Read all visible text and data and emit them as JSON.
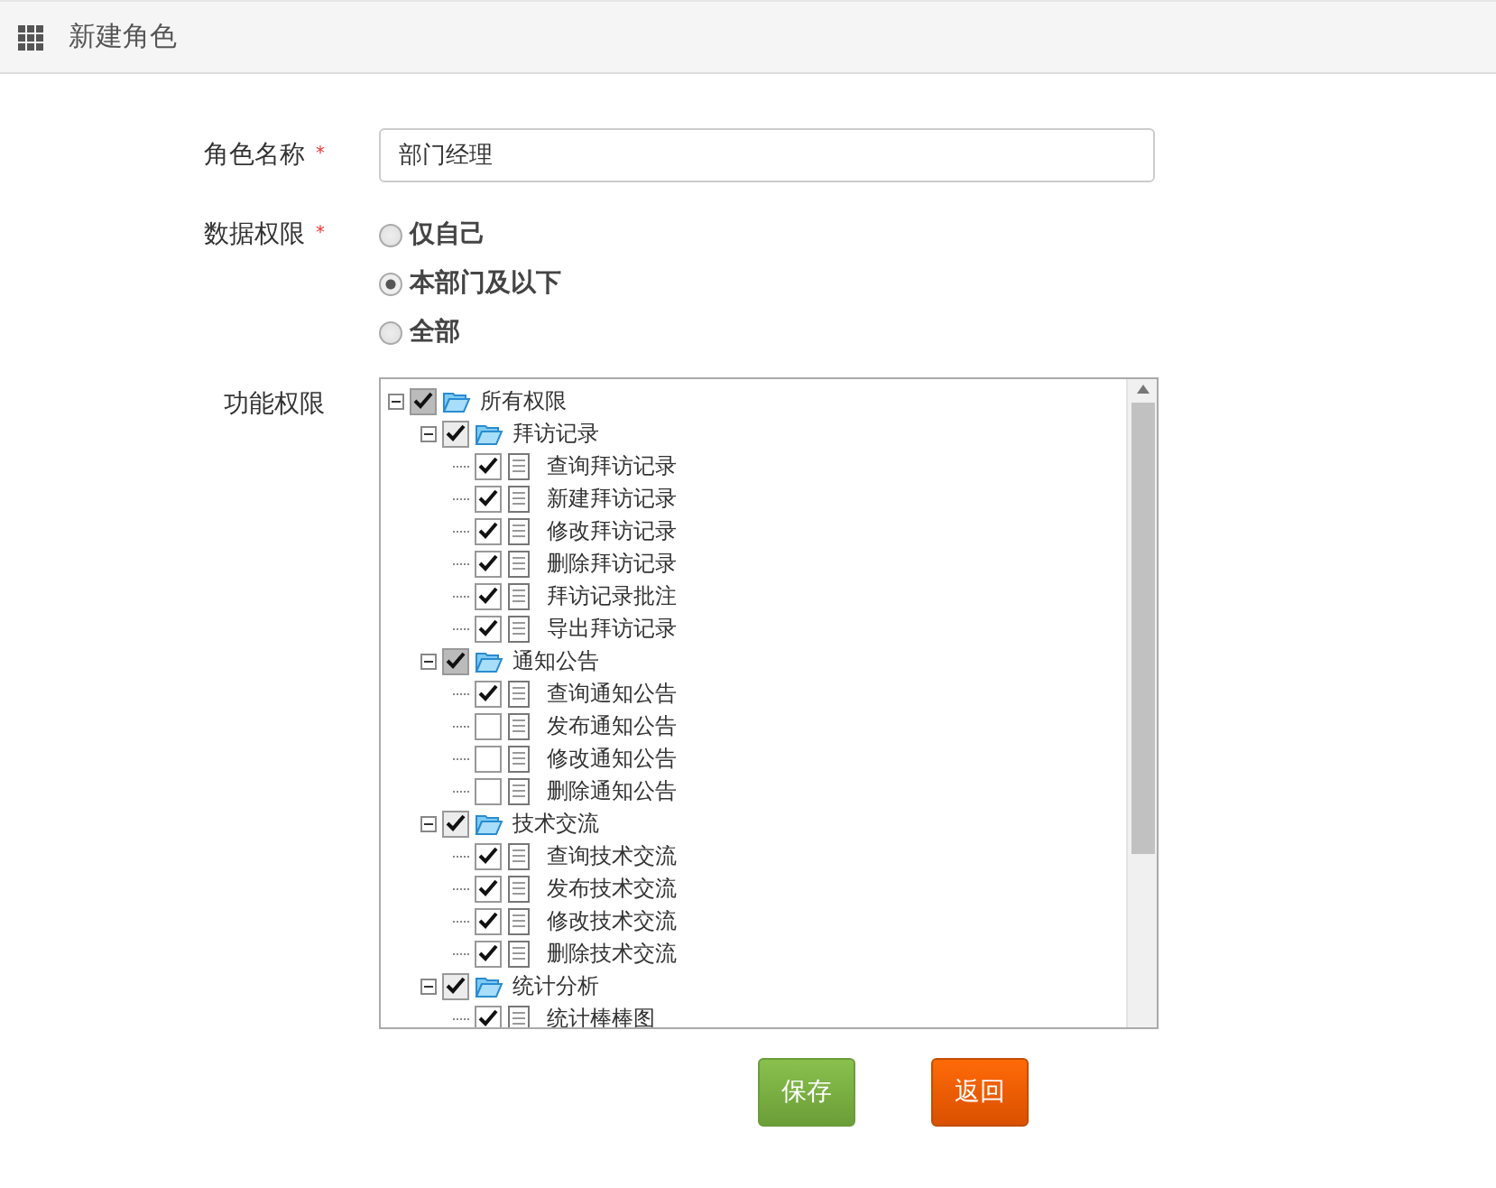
{
  "header": {
    "title": "新建角色"
  },
  "fields": [
    {
      "label": "角色名称",
      "required_mark": "*",
      "value": "部门经理"
    }
  ],
  "data_scope": {
    "label": "数据权限",
    "required_mark": "*",
    "options": [
      {
        "label": "仅自己",
        "selected": false
      },
      {
        "label": "本部门及以下",
        "selected": true
      },
      {
        "label": "全部",
        "selected": false
      }
    ]
  },
  "permissions": {
    "label": "功能权限",
    "tree": [
      {
        "label": "所有权限",
        "kind": "folder",
        "checked": true,
        "partial": true,
        "expanded": true,
        "children": [
          {
            "label": "拜访记录",
            "kind": "folder",
            "checked": true,
            "partial": false,
            "expanded": true,
            "children": [
              {
                "label": "查询拜访记录",
                "kind": "file",
                "checked": true
              },
              {
                "label": "新建拜访记录",
                "kind": "file",
                "checked": true
              },
              {
                "label": "修改拜访记录",
                "kind": "file",
                "checked": true
              },
              {
                "label": "删除拜访记录",
                "kind": "file",
                "checked": true
              },
              {
                "label": "拜访记录批注",
                "kind": "file",
                "checked": true
              },
              {
                "label": "导出拜访记录",
                "kind": "file",
                "checked": true
              }
            ]
          },
          {
            "label": "通知公告",
            "kind": "folder",
            "checked": true,
            "partial": true,
            "expanded": true,
            "children": [
              {
                "label": "查询通知公告",
                "kind": "file",
                "checked": true
              },
              {
                "label": "发布通知公告",
                "kind": "file",
                "checked": false
              },
              {
                "label": "修改通知公告",
                "kind": "file",
                "checked": false
              },
              {
                "label": "删除通知公告",
                "kind": "file",
                "checked": false
              }
            ]
          },
          {
            "label": "技术交流",
            "kind": "folder",
            "checked": true,
            "partial": false,
            "expanded": true,
            "children": [
              {
                "label": "查询技术交流",
                "kind": "file",
                "checked": true
              },
              {
                "label": "发布技术交流",
                "kind": "file",
                "checked": true
              },
              {
                "label": "修改技术交流",
                "kind": "file",
                "checked": true
              },
              {
                "label": "删除技术交流",
                "kind": "file",
                "checked": true
              }
            ]
          },
          {
            "label": "统计分析",
            "kind": "folder",
            "checked": true,
            "partial": false,
            "expanded": true,
            "children": [
              {
                "label": "统计棒棒图",
                "kind": "file",
                "checked": true
              }
            ]
          }
        ]
      }
    ]
  },
  "buttons": [
    {
      "label": "保存",
      "kind": "primary"
    },
    {
      "label": "返回",
      "kind": "back"
    }
  ]
}
